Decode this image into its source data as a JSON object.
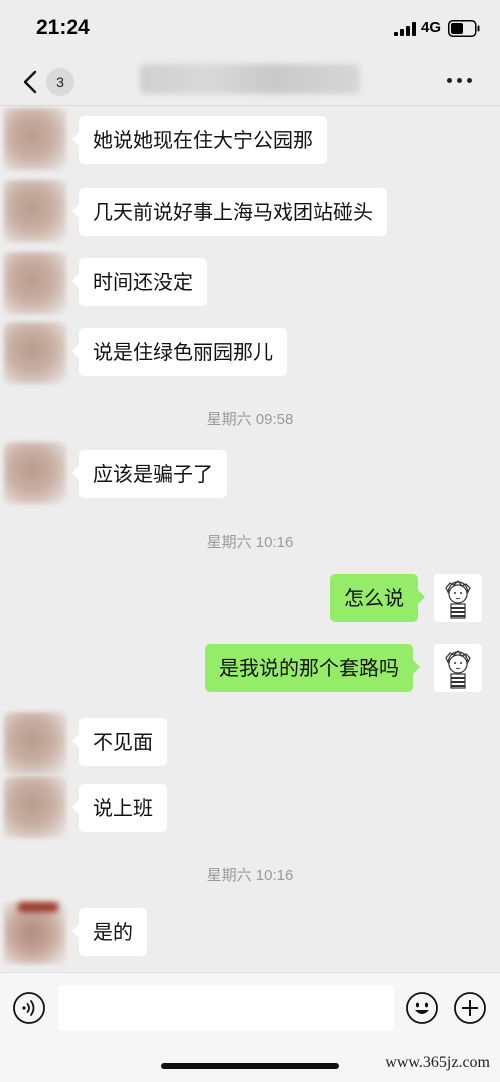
{
  "status_bar": {
    "time": "21:24",
    "network": "4G",
    "icons": [
      "signal-icon",
      "battery-icon"
    ]
  },
  "nav": {
    "unread_count": "3",
    "icons": [
      "back-chevron-icon",
      "more-icon"
    ]
  },
  "messages": [
    {
      "side": "left",
      "text": "她说她现在住大宁公园那"
    },
    {
      "side": "left",
      "text": "几天前说好事上海马戏团站碰头"
    },
    {
      "side": "left",
      "text": "时间还没定"
    },
    {
      "side": "left",
      "text": "说是住绿色丽园那儿"
    },
    {
      "side": "left",
      "text": "应该是骗子了"
    },
    {
      "side": "right",
      "text": "怎么说"
    },
    {
      "side": "right",
      "text": "是我说的那个套路吗"
    },
    {
      "side": "left",
      "text": "不见面"
    },
    {
      "side": "left",
      "text": "说上班"
    },
    {
      "side": "left",
      "text": "是的"
    }
  ],
  "timestamps": [
    "星期六 09:58",
    "星期六 10:16",
    "星期六 10:16"
  ],
  "input_bar": {
    "message_value": "",
    "icons": [
      "voice-icon",
      "emoji-icon",
      "plus-icon"
    ]
  },
  "watermark": "www.365jz.com",
  "colors": {
    "background": "#ededed",
    "incoming_bubble": "#ffffff",
    "outgoing_bubble": "#95ec69",
    "timestamp_text": "#9a9a9a"
  }
}
